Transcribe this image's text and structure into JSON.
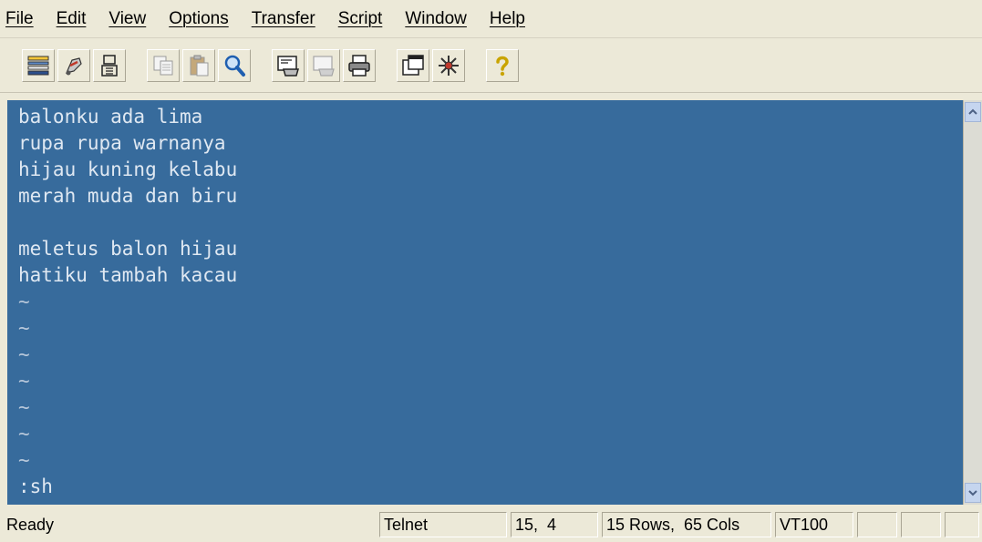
{
  "menu": {
    "items": [
      "File",
      "Edit",
      "View",
      "Options",
      "Transfer",
      "Script",
      "Window",
      "Help"
    ]
  },
  "toolbar": {
    "icons": [
      "connect-icon",
      "quick-connect-icon",
      "connect-tab-icon",
      "copy-icon",
      "paste-icon",
      "find-icon",
      "print-screen-icon",
      "print-selection-icon",
      "print-icon",
      "session-options-icon",
      "global-options-icon",
      "help-icon"
    ]
  },
  "terminal": {
    "background": "#376b9c",
    "lines": [
      "balonku ada lima",
      "rupa rupa warnanya",
      "hijau kuning kelabu",
      "merah muda dan biru",
      "",
      "meletus balon hijau",
      "hatiku tambah kacau",
      "~",
      "~",
      "~",
      "~",
      "~",
      "~",
      "~",
      ":sh"
    ]
  },
  "status": {
    "message": "Ready",
    "protocol": "Telnet",
    "cursor": "15,  4",
    "size": "15 Rows,  65 Cols",
    "emulation": "VT100"
  }
}
